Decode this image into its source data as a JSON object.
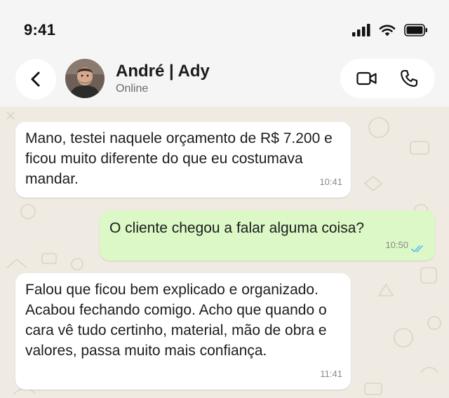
{
  "status_bar": {
    "time": "9:41",
    "icons": [
      "cellular-signal-icon",
      "wifi-icon",
      "battery-icon"
    ]
  },
  "header": {
    "back_icon": "chevron-left-icon",
    "contact_name": "André | Ady",
    "contact_status": "Online",
    "video_call_icon": "video-camera-icon",
    "voice_call_icon": "phone-icon"
  },
  "colors": {
    "incoming_bubble": "#ffffff",
    "outgoing_bubble": "#dcf8c6",
    "chat_background": "#efeae2",
    "read_ticks": "#53bdeb"
  },
  "messages": [
    {
      "direction": "incoming",
      "text": "Mano, testei naquele orçamento de R$ 7.200 e ficou muito diferente do que eu costumava mandar.",
      "time": "10:41"
    },
    {
      "direction": "outgoing",
      "text": "O cliente chegou a falar alguma coisa?",
      "time": "10:50",
      "status_icon": "double-check-read-icon"
    },
    {
      "direction": "incoming",
      "text": "Falou que ficou bem explicado e organizado. Acabou fechando comigo. Acho que quando o cara vê tudo certinho, material, mão de obra e valores, passa muito mais confiança.",
      "time": "11:41"
    }
  ]
}
